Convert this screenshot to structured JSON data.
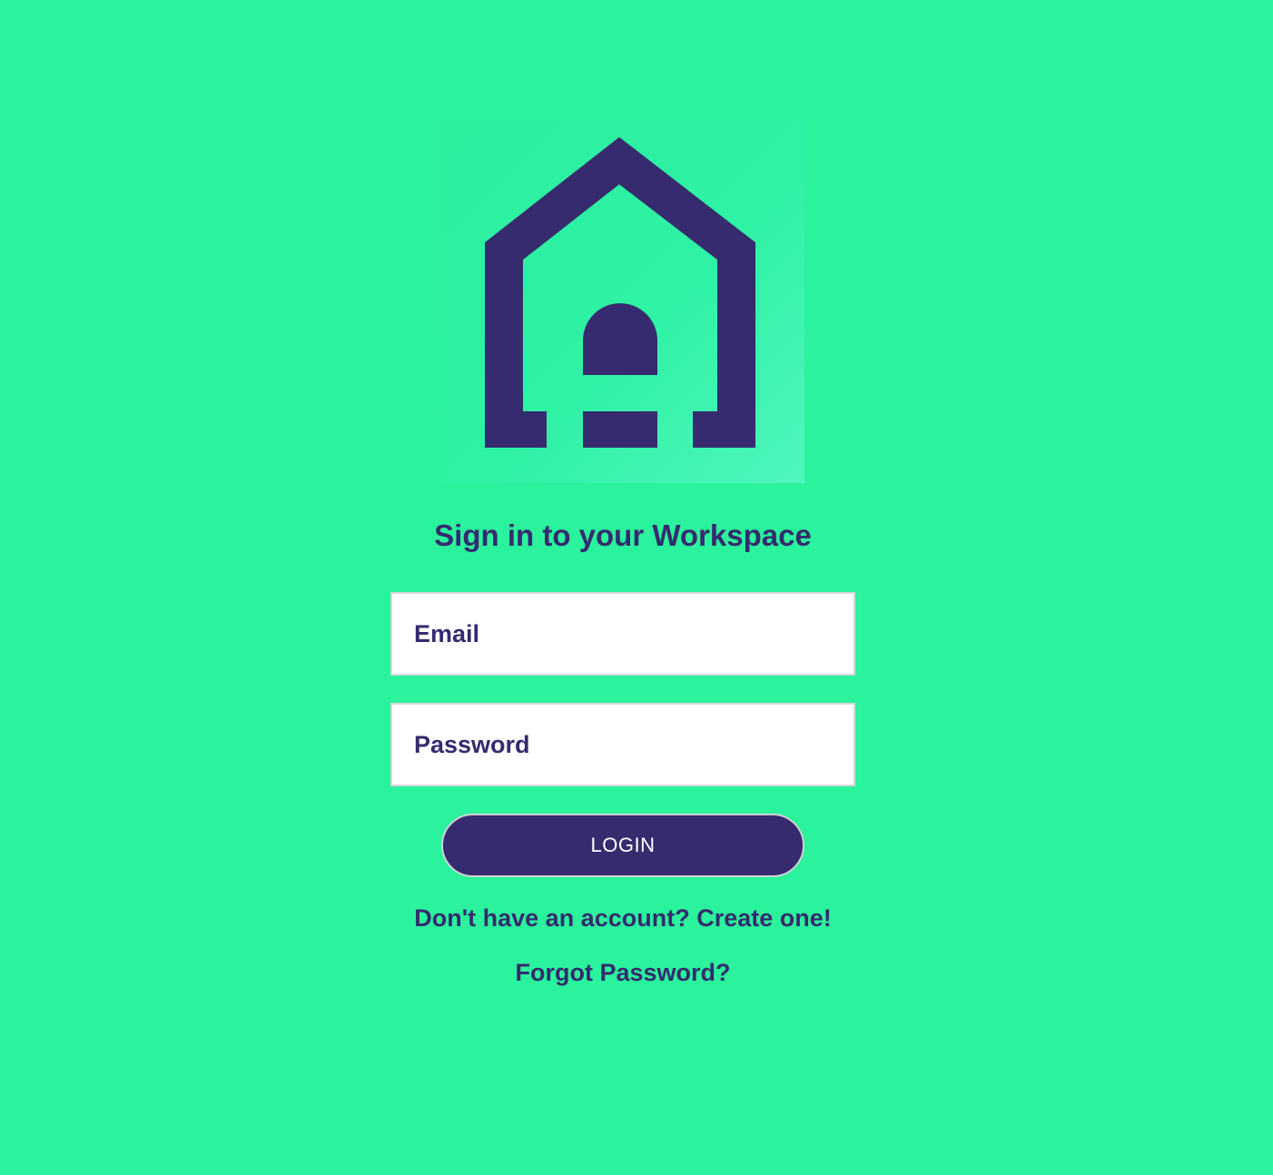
{
  "logo": {
    "icon": "house-door-icon",
    "color": "#352b6e"
  },
  "page": {
    "background_color": "#2bf29d",
    "title": "Sign in to your Workspace"
  },
  "form": {
    "email_placeholder": "Email",
    "password_placeholder": "Password",
    "login_label": "LOGIN",
    "signup_link": "Don't have an account? Create one!",
    "forgot_password_link": "Forgot Password?"
  }
}
